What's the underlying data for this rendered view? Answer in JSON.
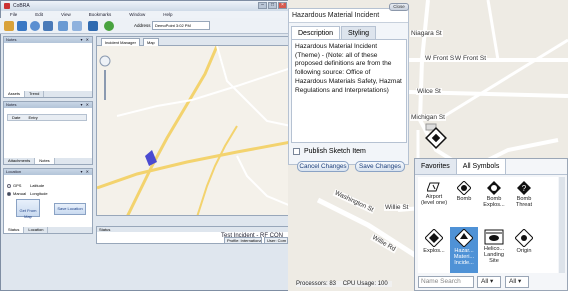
{
  "app": {
    "title": "CoBRA",
    "menu": [
      "File",
      "Edit",
      "View",
      "Bookmarks",
      "Window",
      "Help"
    ],
    "address_label": "Address",
    "address_value": "DemoPoint 3:02 PM"
  },
  "left_panels": {
    "notes_title": "Notes",
    "notes_tabs": [
      "Assets",
      "Trend"
    ],
    "entries_title": "Notes",
    "entries_columns": [
      "Date",
      "Entry"
    ],
    "entries_tabs": [
      "Attachments",
      "Notes"
    ],
    "location_title": "Location",
    "location_options": [
      "GPS",
      "Manual"
    ],
    "latitude_label": "Latitude",
    "longitude_label": "Longitude",
    "get_from_map": "Get From Map",
    "save_location": "Save Location",
    "bottom_tabs": [
      "Status",
      "Location"
    ]
  },
  "map_window": {
    "tabs": [
      "Incident Manager",
      "Map"
    ]
  },
  "status_bar": {
    "title": "Status",
    "incident": "Test Incident - RF CON",
    "profile": "Profile: International",
    "user": "User: Com"
  },
  "streets": [
    "Niagara St",
    "W Front St",
    "W Front St",
    "Wilce St",
    "Michigan St",
    "Washington St",
    "Willie St",
    "Willie Rd"
  ],
  "dialog": {
    "title": "Hazardous Material Incident",
    "close": "Close",
    "tabs": [
      "Description",
      "Styling"
    ],
    "description": "Hazardous Material Incident (Theme) - (Note: all of these proposed definitions are from the following source: Office of Hazardous Materials Safety, Hazmat Regulations and Interpretations)",
    "checkbox_label": "Publish Sketch Item",
    "cancel": "Cancel Changes",
    "save": "Save Changes"
  },
  "palette": {
    "tabs": [
      "Favorites",
      "All Symbols"
    ],
    "symbols": [
      {
        "label": "Airport (level one)",
        "icon": "airport-icon"
      },
      {
        "label": "Bomb",
        "icon": "bomb-icon"
      },
      {
        "label": "Bomb Explos...",
        "icon": "bomb-explosion-icon"
      },
      {
        "label": "Bomb Threat",
        "icon": "bomb-threat-icon"
      },
      {
        "label": "Explos...",
        "icon": "explosion-icon"
      },
      {
        "label": "Hazar... Materi... Incide...",
        "icon": "hazmat-icon",
        "selected": true
      },
      {
        "label": "Helico... Landing Site",
        "icon": "helicopter-icon"
      },
      {
        "label": "Origin",
        "icon": "origin-icon"
      }
    ],
    "search_placeholder": "Name Search",
    "filter1": "All",
    "filter2": "All"
  },
  "footer": {
    "processors": "Processors: 83",
    "cpu": "CPU Usage: 100"
  }
}
